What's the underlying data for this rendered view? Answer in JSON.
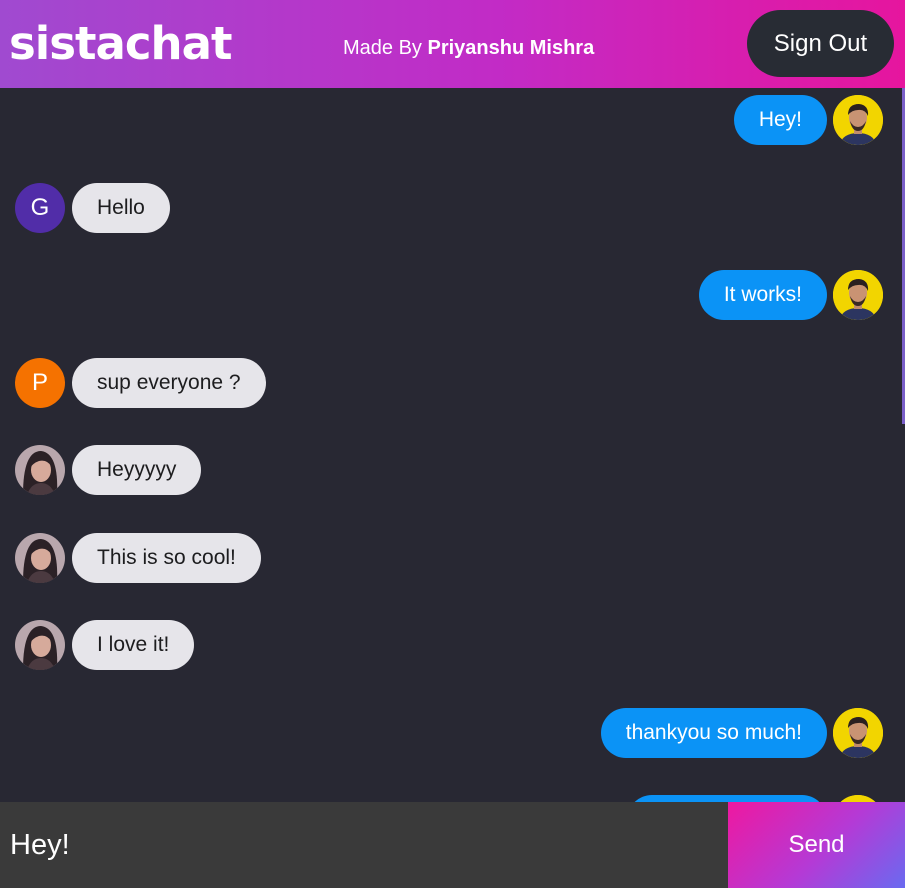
{
  "header": {
    "brand": "sistachat",
    "made_by_prefix": "Made By ",
    "made_by_name": "Priyanshu Mishra",
    "sign_out_label": "Sign Out"
  },
  "messages": [
    {
      "side": "sent",
      "text": "Hey!",
      "avatar": "photo-male-user"
    },
    {
      "side": "received",
      "text": "Hello",
      "avatar": "G"
    },
    {
      "side": "sent",
      "text": "It works!",
      "avatar": "photo-male-user"
    },
    {
      "side": "received",
      "text": "sup everyone ?",
      "avatar": "P"
    },
    {
      "side": "received",
      "text": "Heyyyyy",
      "avatar": "photo-female-user"
    },
    {
      "side": "received",
      "text": "This is so cool!",
      "avatar": "photo-female-user"
    },
    {
      "side": "received",
      "text": "I love it!",
      "avatar": "photo-female-user"
    },
    {
      "side": "sent",
      "text": "thankyou so much!",
      "avatar": "photo-male-user"
    },
    {
      "side": "sent",
      "text": "",
      "avatar": "photo-male-user"
    }
  ],
  "composer": {
    "input_value": "Hey!",
    "send_label": "Send"
  },
  "colors": {
    "header_gradient": [
      "#a04ad0",
      "#e6159e"
    ],
    "chat_background": "#282833",
    "sent_bubble": "#0b93f6",
    "received_bubble": "#e6e5ea",
    "avatar_g": "#512da8",
    "avatar_p": "#f57200",
    "avatar_photo_bg": "#f2d500"
  }
}
